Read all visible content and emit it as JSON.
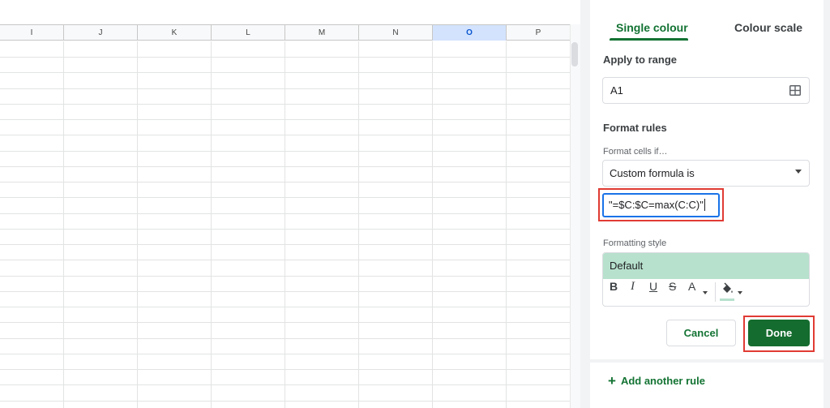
{
  "sheet": {
    "columns": [
      "I",
      "J",
      "K",
      "L",
      "M",
      "N",
      "O",
      "P"
    ],
    "selected_column": "O"
  },
  "panel": {
    "tabs": [
      "Single colour",
      "Colour scale"
    ],
    "active_tab": "Single colour",
    "apply_to_range": {
      "label": "Apply to range",
      "value": "A1",
      "icon": "grid-select-icon"
    },
    "format_rules": {
      "heading": "Format rules",
      "condition_label": "Format cells if…",
      "condition_value": "Custom formula is",
      "formula_value": "\"=$C:$C=max(C:C)\""
    },
    "formatting_style": {
      "label": "Formatting style",
      "preset": "Default",
      "preset_color": "#b7e1cd",
      "toolbar": {
        "bold": "B",
        "italic": "I",
        "underline": "U",
        "strikethrough": "S",
        "text_color": "A",
        "fill_icon": "paint-bucket-icon"
      }
    },
    "buttons": {
      "cancel": "Cancel",
      "done": "Done"
    },
    "add_rule": "Add another rule"
  },
  "colors": {
    "accent_green": "#137333",
    "done_green": "#146c2e",
    "highlight_red": "#e03b34",
    "focus_blue": "#1a73e8"
  }
}
